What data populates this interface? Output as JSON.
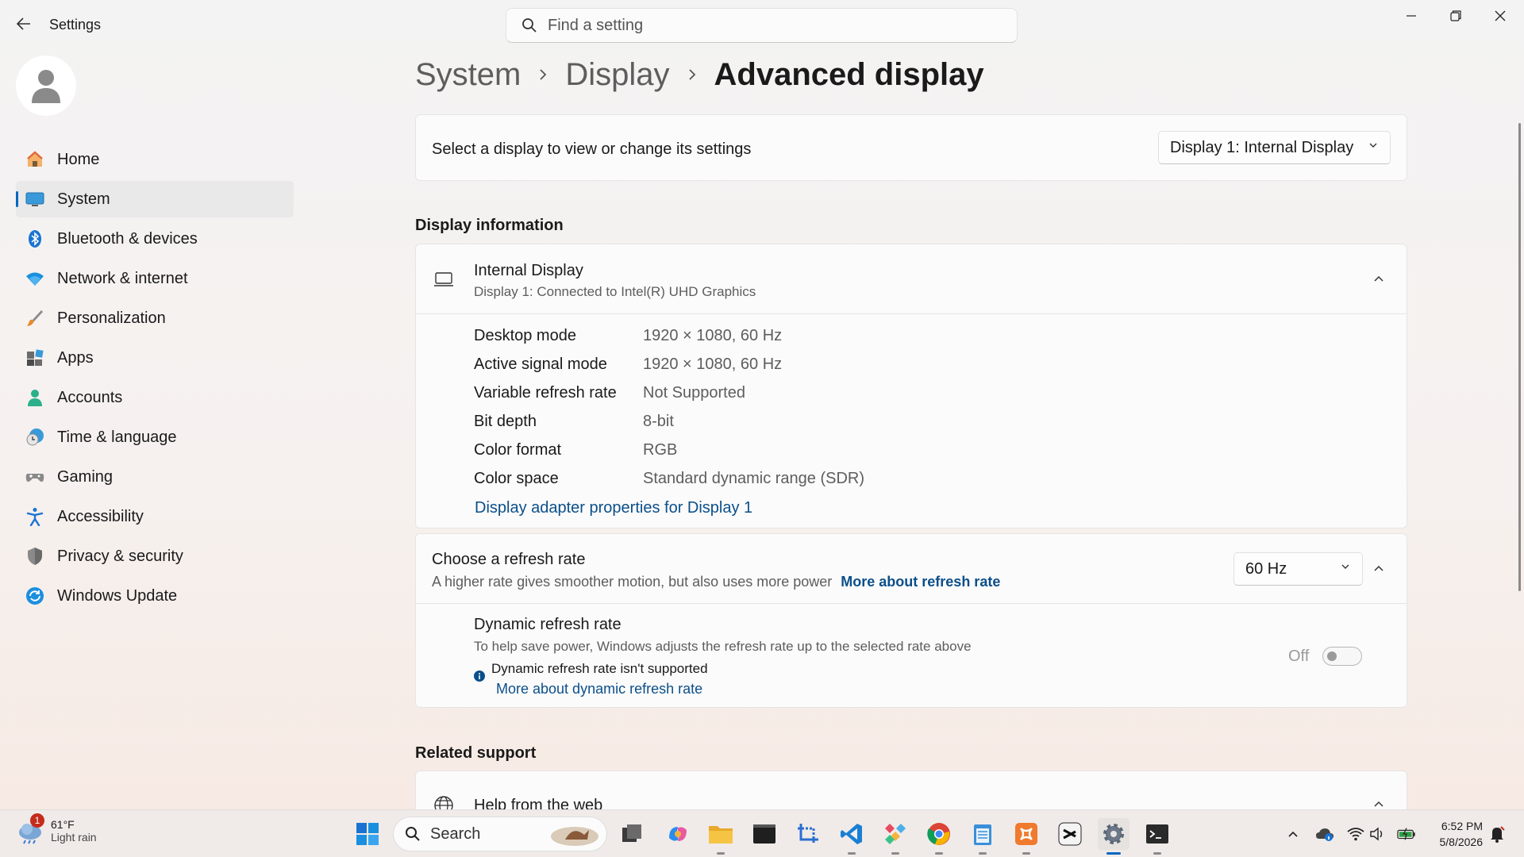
{
  "window": {
    "app_title": "Settings",
    "back_label": "←",
    "minimize_label": "—",
    "maximize_label": "❐",
    "close_label": "✕"
  },
  "search": {
    "placeholder": "Find a setting"
  },
  "sidebar": {
    "items": [
      {
        "label": "Home",
        "icon": "home-icon"
      },
      {
        "label": "System",
        "icon": "system-icon",
        "selected": true
      },
      {
        "label": "Bluetooth & devices",
        "icon": "bluetooth-icon"
      },
      {
        "label": "Network & internet",
        "icon": "wifi-icon"
      },
      {
        "label": "Personalization",
        "icon": "brush-icon"
      },
      {
        "label": "Apps",
        "icon": "apps-icon"
      },
      {
        "label": "Accounts",
        "icon": "person-icon"
      },
      {
        "label": "Time & language",
        "icon": "clock-globe-icon"
      },
      {
        "label": "Gaming",
        "icon": "gamepad-icon"
      },
      {
        "label": "Accessibility",
        "icon": "accessibility-icon"
      },
      {
        "label": "Privacy & security",
        "icon": "shield-icon"
      },
      {
        "label": "Windows Update",
        "icon": "update-icon"
      }
    ]
  },
  "breadcrumb": {
    "items": [
      "System",
      "Display"
    ],
    "current": "Advanced display",
    "separator": "›"
  },
  "display_select": {
    "label": "Select a display to view or change its settings",
    "value": "Display 1: Internal Display"
  },
  "display_info": {
    "section_title": "Display information",
    "name": "Internal Display",
    "subtitle": "Display 1: Connected to Intel(R) UHD Graphics",
    "rows": [
      {
        "key": "Desktop mode",
        "value": "1920 × 1080, 60 Hz"
      },
      {
        "key": "Active signal mode",
        "value": "1920 × 1080, 60 Hz"
      },
      {
        "key": "Variable refresh rate",
        "value": "Not Supported"
      },
      {
        "key": "Bit depth",
        "value": "8-bit"
      },
      {
        "key": "Color format",
        "value": "RGB"
      },
      {
        "key": "Color space",
        "value": "Standard dynamic range (SDR)"
      }
    ],
    "adapter_link": "Display adapter properties for Display 1"
  },
  "refresh_rate": {
    "title": "Choose a refresh rate",
    "description": "A higher rate gives smoother motion, but also uses more power",
    "more_link": "More about refresh rate",
    "value": "60 Hz",
    "dynamic": {
      "title": "Dynamic refresh rate",
      "description": "To help save power, Windows adjusts the refresh rate up to the selected rate above",
      "notice": "Dynamic refresh rate isn't supported",
      "more_link": "More about dynamic refresh rate",
      "toggle_label": "Off",
      "toggle_on": false
    }
  },
  "related_support": {
    "section_title": "Related support",
    "help_title": "Help from the web"
  },
  "taskbar": {
    "weather_badge": "1",
    "weather_temp": "61°F",
    "weather_cond": "Light rain",
    "search_label": "Search",
    "time": "6:52 PM",
    "date": "5/8/2026"
  },
  "colors": {
    "accent": "#0067c0",
    "link": "#0b4f8a"
  }
}
